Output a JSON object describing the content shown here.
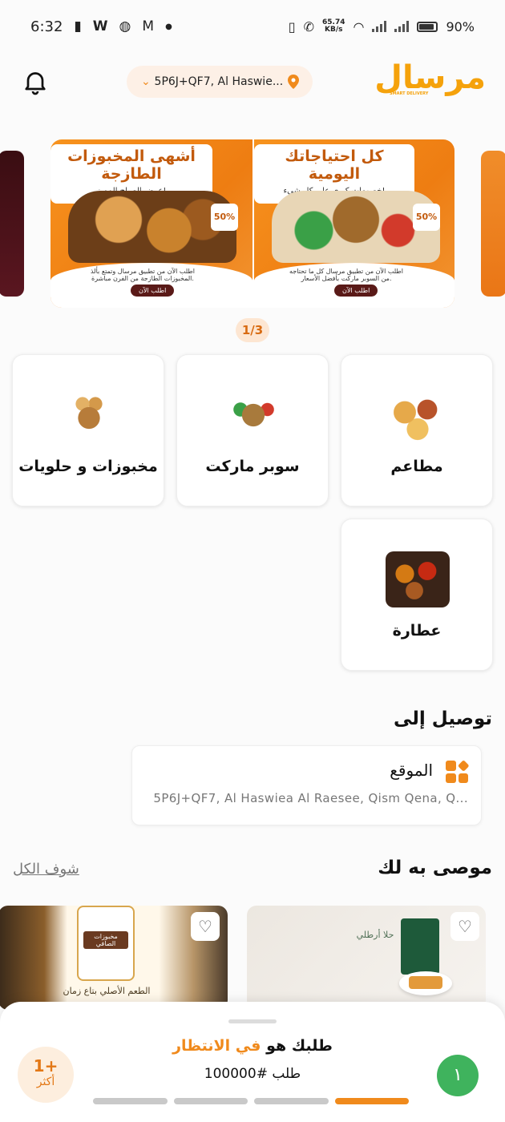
{
  "status_bar": {
    "time": "6:32",
    "net_speed_value": "65.74",
    "net_speed_unit": "KB/s",
    "battery": "90%",
    "notification_icons": [
      "battery-saver-icon",
      "w-app-icon",
      "bear-app-icon",
      "gmail-icon",
      "dot-icon"
    ]
  },
  "header": {
    "location": "5P6J+QF7, Al Haswie...",
    "logo_text": "مرسال",
    "logo_tagline": "SMART DELIVERY"
  },
  "banner": {
    "pager": "1/3",
    "slides": [
      {
        "title": "أشهى المخبوزات الطازجة",
        "subtitle": "عرض الصباح المميز!",
        "badge": "50%",
        "body": "اطلب الآن من تطبيق مرسال وتمتع بألذ المخبوزات الطازجة من الفرن مباشرة.",
        "cta": "اطلب الآن"
      },
      {
        "title": "كل احتياجاتك اليومية",
        "subtitle": "خصومات كبرى على كل شيء!",
        "badge": "50%",
        "body": "اطلب الآن من تطبيق مرسال كل ما تحتاجه من السوبر ماركت بأفضل الأسعار.",
        "cta": "اطلب الآن"
      }
    ]
  },
  "categories": [
    {
      "label": "مطاعم",
      "icon": "restaurant-food-image"
    },
    {
      "label": "سوبر ماركت",
      "icon": "grocery-basket-image"
    },
    {
      "label": "مخبوزات و حلويات",
      "icon": "bread-basket-image"
    },
    {
      "label": "عطارة",
      "icon": "spices-image"
    }
  ],
  "delivery": {
    "title": "توصيل إلى",
    "card_title": "الموقع",
    "address": "5P6J+QF7, Al Haswiea Al Raesee, Qism Qena, Q..."
  },
  "recommended": {
    "title": "موصى به لك",
    "see_all": "شوف الكل",
    "items": [
      {
        "name": "مخبوزات الصافي",
        "tagline": "الطعم الأصلي بتاع زمان"
      },
      {
        "name": "حلا أرطلي"
      }
    ]
  },
  "order_sheet": {
    "status_prefix": "طلبك هو",
    "status_highlight": "في الانتظار",
    "order_number": "طلب #100000",
    "more_count": "1+",
    "more_label": "أكثر",
    "badge": "١",
    "progress_steps_total": 4,
    "progress_steps_active": 1
  },
  "colors": {
    "accent": "#f08a1c",
    "success": "#3fb35d"
  }
}
